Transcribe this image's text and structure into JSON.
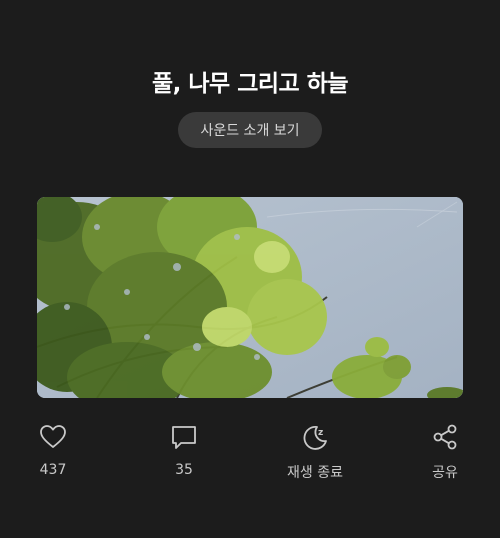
{
  "title": "풀, 나무 그리고 하늘",
  "sound_intro_button": "사운드 소개 보기",
  "photo": {
    "icon": "tree-canopy-sky-photo"
  },
  "actions": [
    {
      "icon": "heart-icon",
      "label": "437"
    },
    {
      "icon": "comment-icon",
      "label": "35"
    },
    {
      "icon": "sleep-timer-icon",
      "label": "재생 종료"
    },
    {
      "icon": "share-icon",
      "label": "공유"
    }
  ],
  "colors": {
    "background": "#1c1c1c",
    "button_bg": "#3a3a3a",
    "icon_stroke": "#c9c9c9",
    "sky": "#a8b6c6"
  }
}
